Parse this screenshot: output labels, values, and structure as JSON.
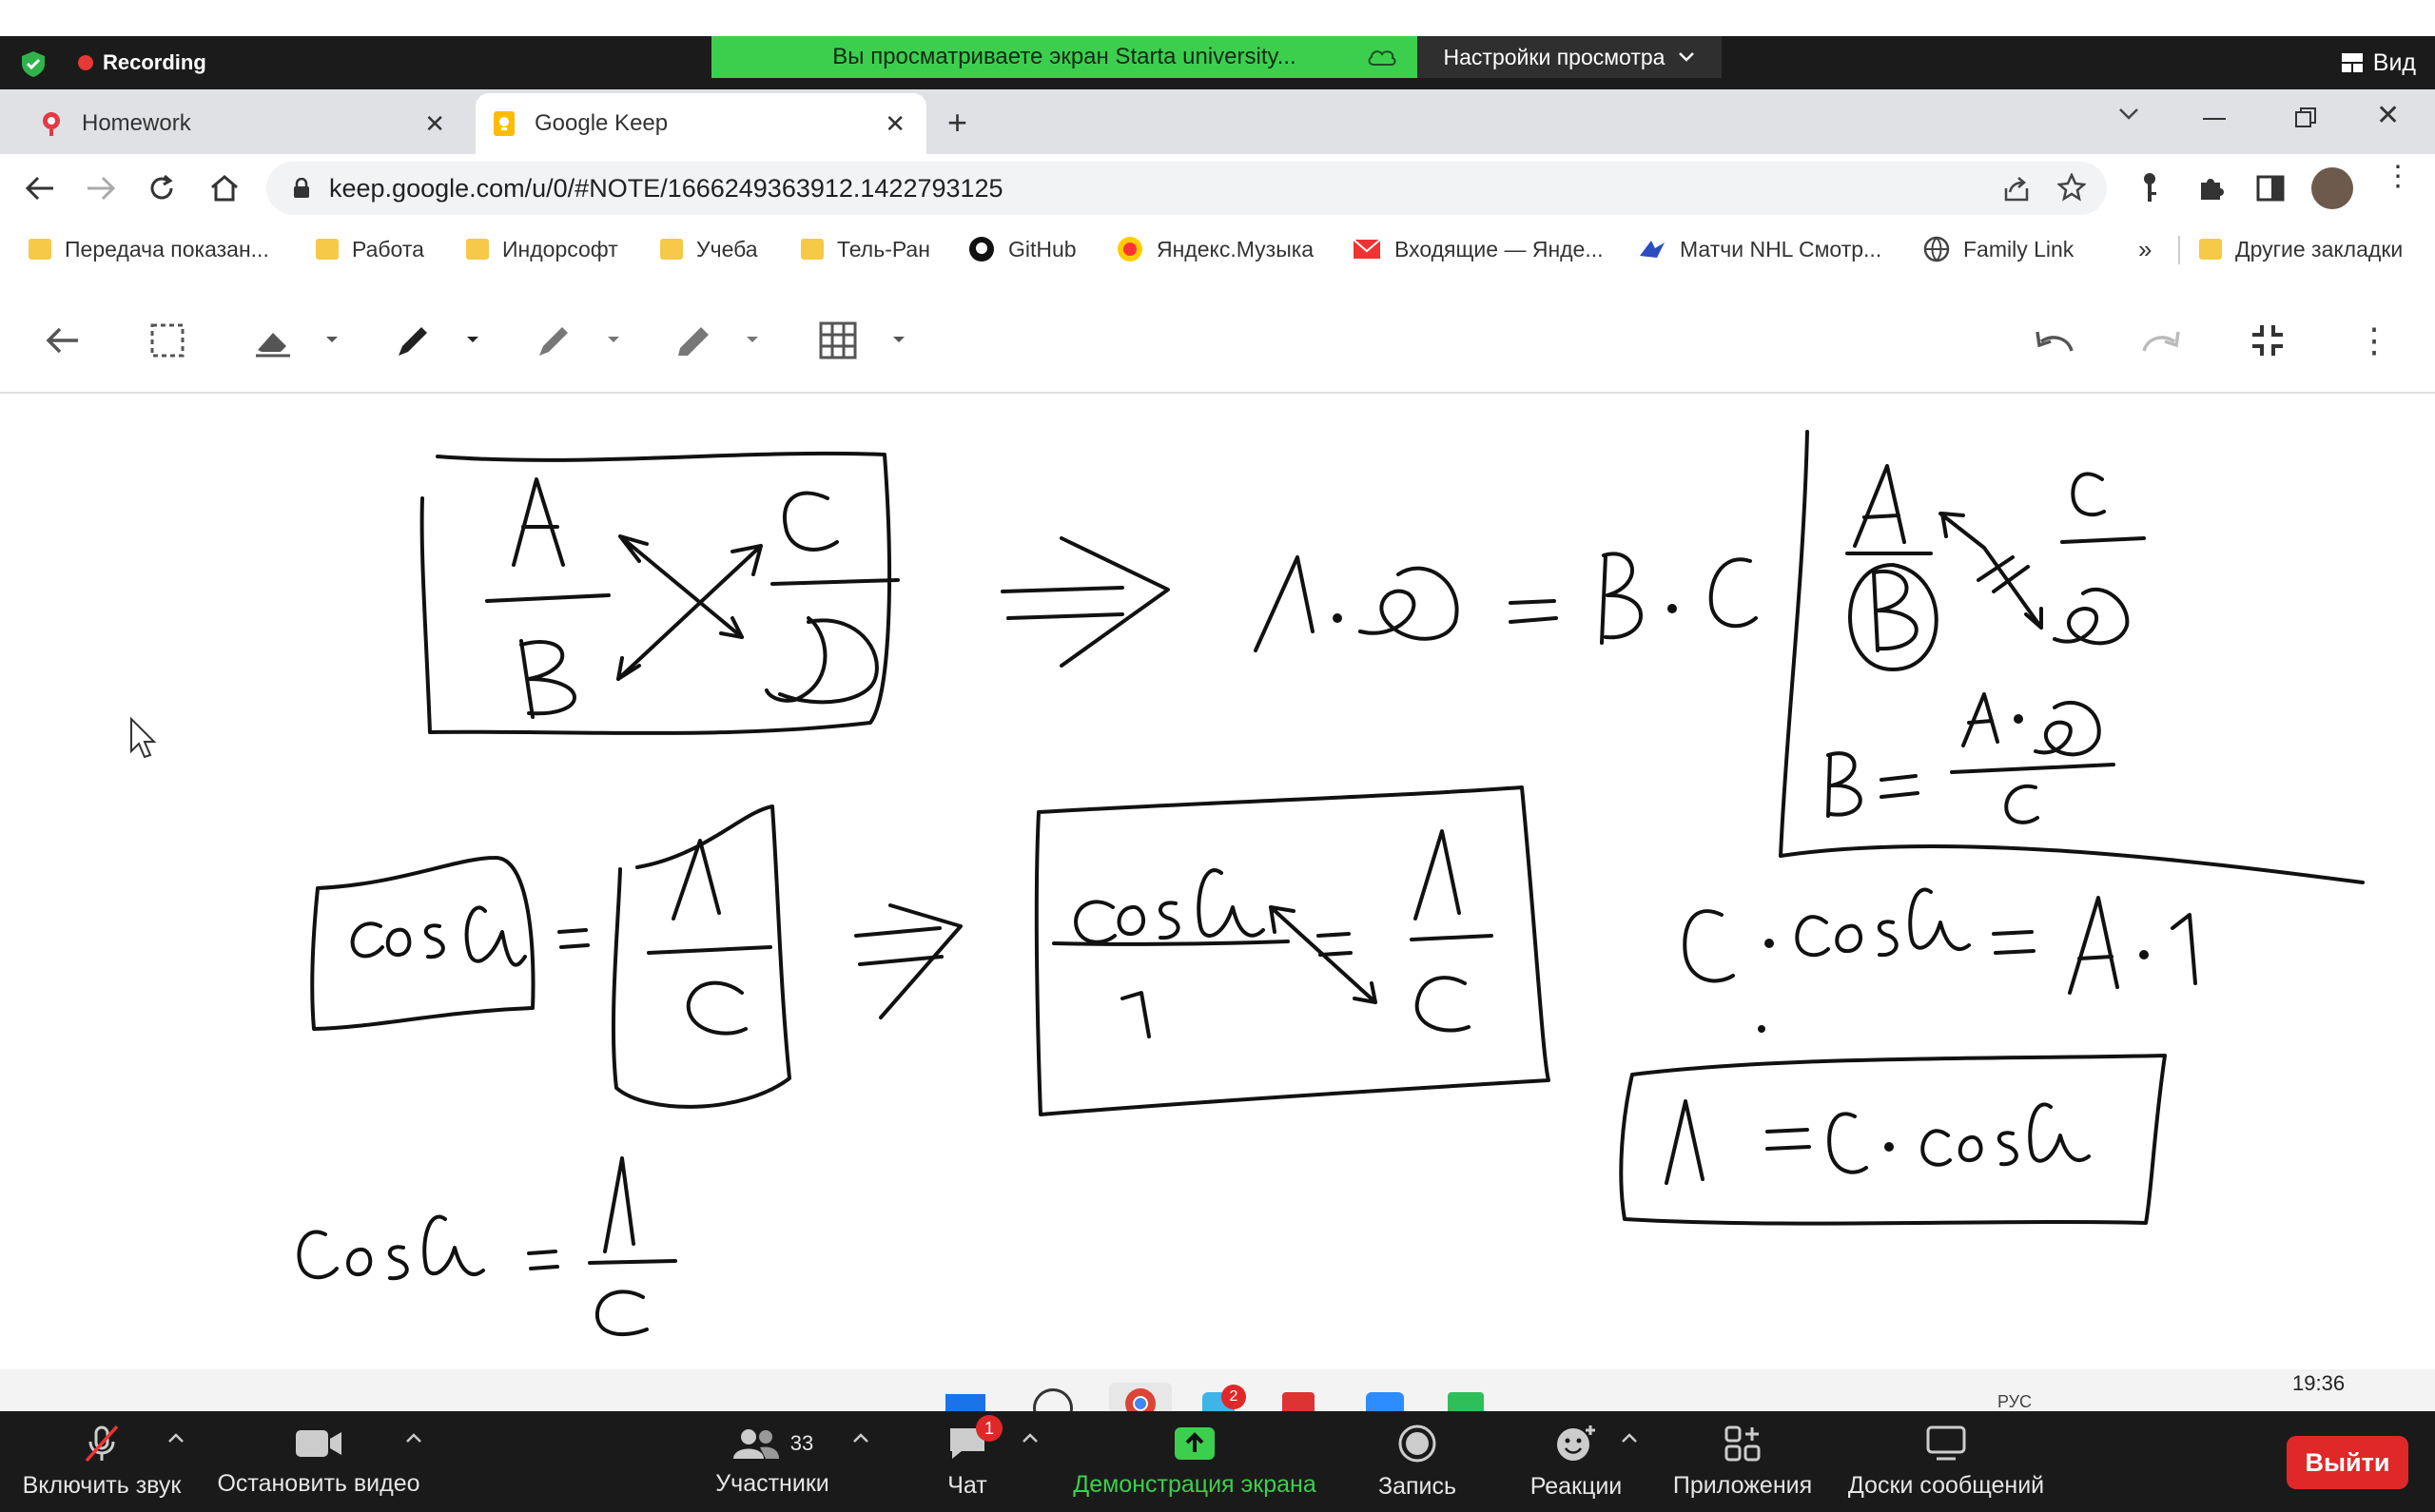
{
  "zoom_top": {
    "recording_label": "Recording",
    "share_banner": "Вы просматриваете экран Starta university...",
    "view_settings": "Настройки просмотра",
    "view_button": "Вид"
  },
  "browser": {
    "tabs": [
      {
        "title": "Homework",
        "active": false
      },
      {
        "title": "Google Keep",
        "active": true
      }
    ],
    "url": "keep.google.com/u/0/#NOTE/1666249363912.1422793125",
    "bookmarks": [
      "Передача показан...",
      "Работа",
      "Индорсофт",
      "Учеба",
      "Тель-Ран",
      "GitHub",
      "Яндекс.Музыка",
      "Входящие — Янде...",
      "Матчи NHL Смотр...",
      "Family Link"
    ],
    "bookmarks_more": "»",
    "other_bookmarks": "Другие закладки"
  },
  "taskbar": {
    "time": "19:36",
    "lang": "РУС",
    "notif_badge": "2"
  },
  "zoom_controls": {
    "unmute": "Включить звук",
    "stop_video": "Остановить видео",
    "participants": "Участники",
    "participants_count": "33",
    "chat": "Чат",
    "chat_badge": "1",
    "share_screen": "Демонстрация экрана",
    "record": "Запись",
    "reactions": "Реакции",
    "apps": "Приложения",
    "whiteboards": "Доски сообщений",
    "leave": "Выйти"
  },
  "colors": {
    "share_green": "#3ccf4e",
    "zoom_dark": "#1a1a1a",
    "leave_red": "#e02828",
    "ink": "#111111"
  }
}
